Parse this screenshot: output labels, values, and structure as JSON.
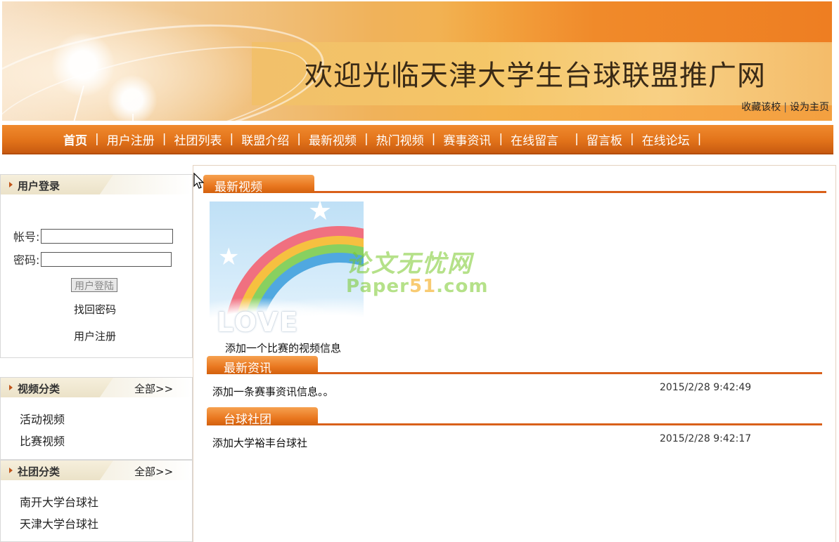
{
  "header": {
    "title": "欢迎光临天津大学生台球联盟推广网",
    "favorite_link": "收藏该校",
    "separator": "|",
    "homepage_link": "设为主页"
  },
  "nav": {
    "items": [
      "首页",
      "用户注册",
      "社团列表",
      "联盟介绍",
      "最新视频",
      "热门视频",
      "赛事资讯",
      "在线留言",
      "留言板",
      "在线论坛"
    ],
    "separator": "|"
  },
  "login": {
    "title": "用户登录",
    "account_label": "帐号:",
    "account_value": "",
    "password_label": "密码:",
    "password_value": "",
    "login_button": "用户登陆",
    "forgot_link": "找回密码",
    "register_link": "用户注册"
  },
  "video_categories": {
    "title": "视频分类",
    "more": "全部>>",
    "items": [
      "活动视频",
      "比赛视频"
    ]
  },
  "club_categories": {
    "title": "社团分类",
    "more": "全部>>",
    "items": [
      "南开大学台球社",
      "天津大学台球社"
    ]
  },
  "latest_video": {
    "title": "最新视频",
    "thumbnail_text": "LOVE",
    "caption": "添加一个比赛的视频信息"
  },
  "latest_news": {
    "title": "最新资讯",
    "items": [
      {
        "text": "添加一条赛事资讯信息。。",
        "date": "2015/2/28 9:42:49"
      }
    ]
  },
  "clubs": {
    "title": "台球社团",
    "items": [
      {
        "text": "添加大学裕丰台球社",
        "date": "2015/2/28 9:42:17"
      }
    ]
  },
  "watermark": {
    "line1": "论文无忧网",
    "line2a": "Paper",
    "line2b": "51",
    "line2c": ".com"
  },
  "colors": {
    "nav_orange": "#e2731a",
    "section_orange": "#d9601a",
    "banner_gold": "#f0b25a"
  }
}
